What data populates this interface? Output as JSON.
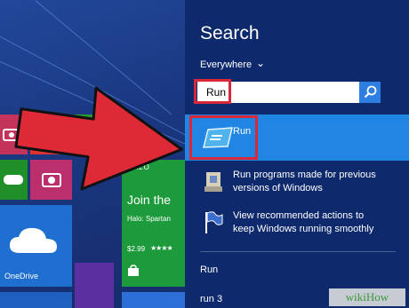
{
  "start": {
    "halo_title": "Join the",
    "halo_brand": "HALO",
    "halo_subtitle": "Halo: Spartan",
    "halo_price": "$2.99",
    "onedrive_label": "OneDrive"
  },
  "search": {
    "title": "Search",
    "scope_label": "Everywhere",
    "query": "Run"
  },
  "results": [
    {
      "label": "Run",
      "icon": "run-app-icon"
    },
    {
      "label_line1": "Run programs made for previous",
      "label_line2": "versions of Windows",
      "icon": "compatibility-icon"
    },
    {
      "label_line1": "View recommended actions to",
      "label_line2": "keep Windows running smoothly",
      "icon": "flag-icon"
    }
  ],
  "suggestions": [
    "Run",
    "run 3"
  ],
  "watermark": "wikiHow",
  "colors": {
    "panel_bg": "#0f2a6c",
    "selected": "#2185e3",
    "highlight_border": "#d8283a",
    "arrow": "#de2a36",
    "search_button": "#2e7de0"
  }
}
